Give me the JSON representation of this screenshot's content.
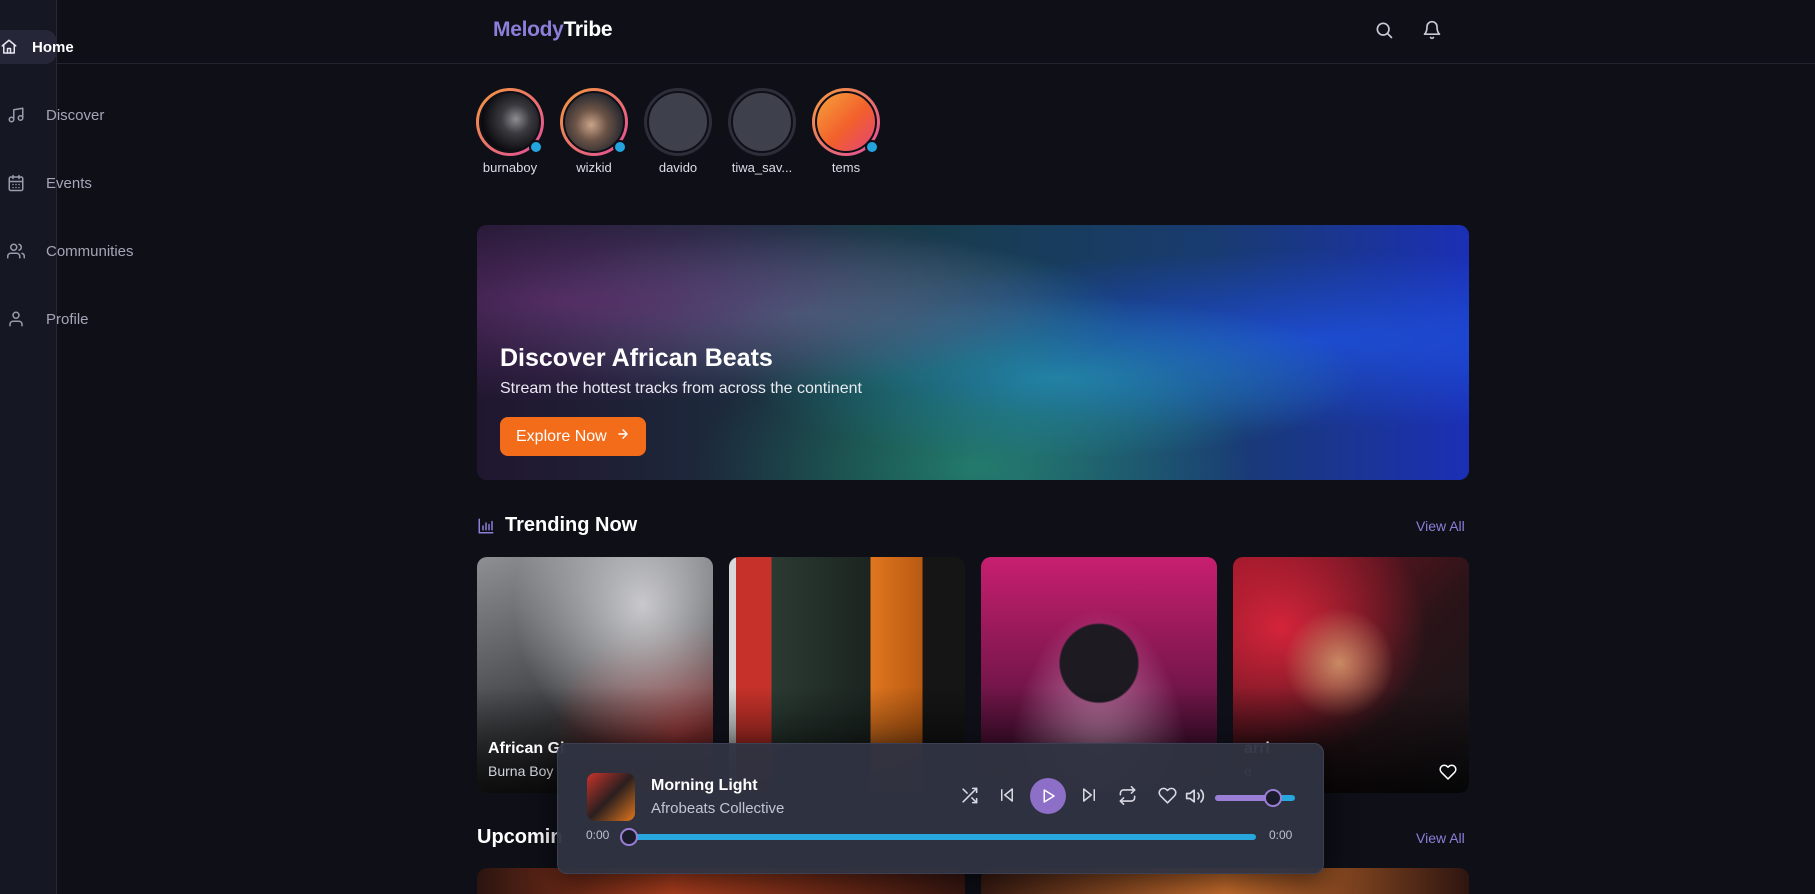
{
  "sidebar": {
    "items": [
      {
        "label": "Home",
        "icon": "home-icon",
        "active": true
      },
      {
        "label": "Discover",
        "icon": "music-note-icon",
        "active": false
      },
      {
        "label": "Events",
        "icon": "calendar-icon",
        "active": false
      },
      {
        "label": "Communities",
        "icon": "users-icon",
        "active": false
      },
      {
        "label": "Profile",
        "icon": "user-icon",
        "active": false
      }
    ]
  },
  "header": {
    "logo_part1": "Melody",
    "logo_part2": "Tribe",
    "icons": [
      "search-icon",
      "bell-icon"
    ]
  },
  "stories": [
    {
      "name": "burnaboy",
      "active": true,
      "online": true
    },
    {
      "name": "wizkid",
      "active": true,
      "online": true
    },
    {
      "name": "davido",
      "active": false,
      "online": false
    },
    {
      "name": "tiwa_sav...",
      "active": false,
      "online": false
    },
    {
      "name": "tems",
      "active": true,
      "online": true
    }
  ],
  "hero": {
    "title": "Discover African Beats",
    "subtitle": "Stream the hottest tracks from across the continent",
    "cta_label": "Explore Now"
  },
  "trending": {
    "title": "Trending Now",
    "view_all": "View All",
    "cards": [
      {
        "title": "African Gi",
        "subtitle": "Burna Boy"
      },
      {
        "title": "",
        "subtitle": ""
      },
      {
        "title": "",
        "subtitle": ""
      },
      {
        "title": "arri",
        "subtitle": "e"
      }
    ]
  },
  "upcoming": {
    "title": "Upcomin",
    "view_all": "View All"
  },
  "player": {
    "title": "Morning Light",
    "artist": "Afrobeats Collective",
    "current_time": "0:00",
    "duration": "0:00",
    "progress": 0,
    "volume": 0.72,
    "accent": "#8d6fc7",
    "progress_color": "#27a7dd"
  },
  "colors": {
    "background": "#0e0f17",
    "brand": "#8b7fd9",
    "cta": "#f26c1a"
  }
}
